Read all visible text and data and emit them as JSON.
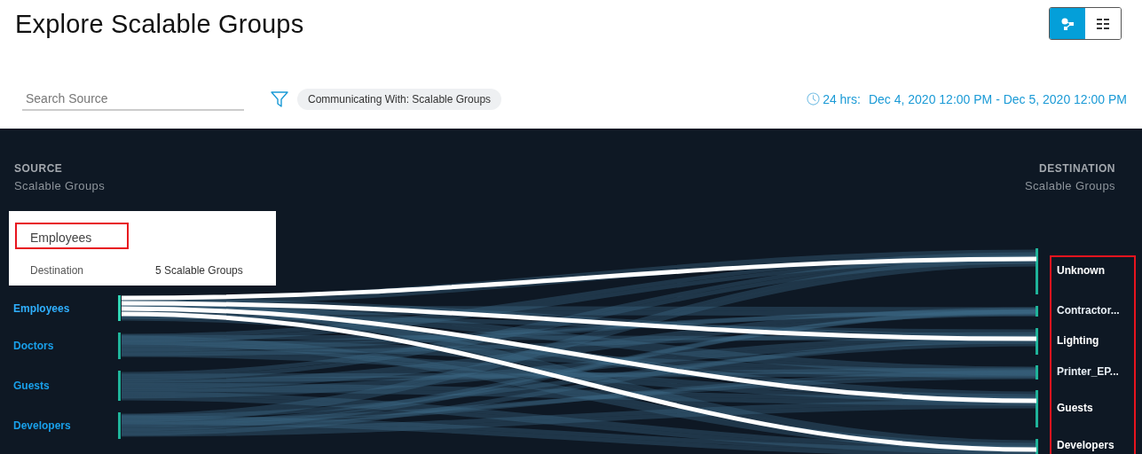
{
  "page": {
    "title": "Explore Scalable Groups"
  },
  "view_toggle": [
    {
      "kind": "diagram",
      "selected": true
    },
    {
      "kind": "list",
      "selected": false
    }
  ],
  "search": {
    "placeholder": "Search Source"
  },
  "filter_chip": "Communicating With: Scalable Groups",
  "time_range": {
    "duration": "24 hrs:",
    "range": "Dec 4, 2020 12:00 PM - Dec 5, 2020 12:00 PM"
  },
  "source_header": {
    "title": "SOURCE",
    "subtitle": "Scalable Groups"
  },
  "destination_header": {
    "title": "DESTINATION",
    "subtitle": "Scalable Groups"
  },
  "tooltip": {
    "title": "Employees",
    "label": "Destination",
    "value": "5 Scalable Groups"
  },
  "sources": [
    {
      "name": "Employees",
      "selected": true
    },
    {
      "name": "Doctors",
      "selected": false
    },
    {
      "name": "Guests",
      "selected": false
    },
    {
      "name": "Developers",
      "selected": false
    }
  ],
  "destinations": [
    {
      "name": "Unknown",
      "linked": true
    },
    {
      "name": "Contractor...",
      "linked": false
    },
    {
      "name": "Lighting",
      "linked": true
    },
    {
      "name": "Printer_EP...",
      "linked": false
    },
    {
      "name": "Guests",
      "linked": true
    },
    {
      "name": "Developers",
      "linked": true
    }
  ]
}
